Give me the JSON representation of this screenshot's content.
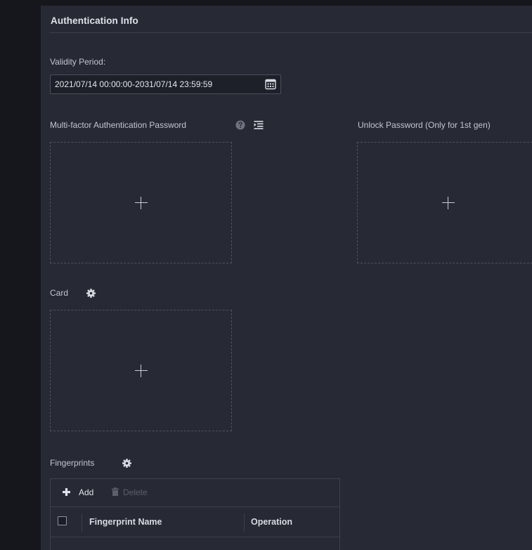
{
  "section": {
    "title": "Authentication Info"
  },
  "validity": {
    "label": "Validity Period:",
    "value": "2021/07/14 00:00:00-2031/07/14 23:59:59",
    "calendar_icon": "calendar-icon"
  },
  "mfa_password": {
    "label": "Multi-factor Authentication Password",
    "help_icon": "help-icon",
    "list_icon": "list-indent-icon",
    "add_icon": "plus-icon"
  },
  "unlock_password": {
    "label": "Unlock Password (Only for 1st gen)",
    "add_icon": "plus-icon"
  },
  "card": {
    "label": "Card",
    "settings_icon": "gear-icon",
    "add_icon": "plus-icon"
  },
  "fingerprints": {
    "label": "Fingerprints",
    "settings_icon": "gear-icon",
    "toolbar": {
      "add_label": "Add",
      "delete_label": "Delete"
    },
    "columns": [
      "Fingerprint Name",
      "Operation"
    ],
    "rows": []
  },
  "colors": {
    "background": "#15171c",
    "panel": "#272a34",
    "text": "#c2c6d0",
    "disabled": "#5c606b"
  }
}
